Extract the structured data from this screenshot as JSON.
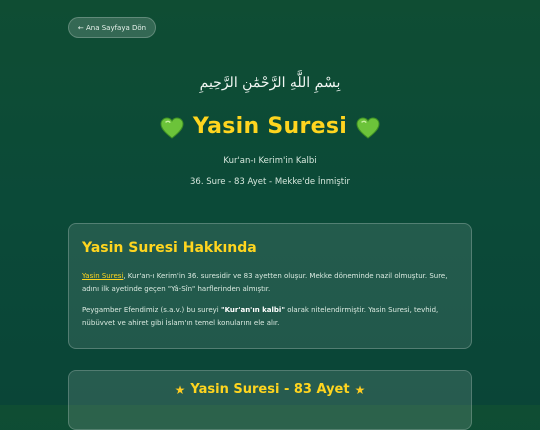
{
  "nav": {
    "back_label": "← Ana Sayfaya Dön"
  },
  "header": {
    "basmala": "بِسْمِ اللَّهِ الرَّحْمَٰنِ الرَّحِيمِ",
    "title": "Yasin Suresi",
    "title_icon": "green-heart-icon",
    "subtitle": "Kur'an-ı Kerim'in Kalbi",
    "meta": "36. Sure - 83 Ayet - Mekke'de İnmiştir"
  },
  "about": {
    "title": "Yasin Suresi Hakkında",
    "p1_link": "Yasin Suresi",
    "p1_rest": ", Kur'an-ı Kerim'in 36. suresidir ve 83 ayetten oluşur. Mekke döneminde nazil olmuştur. Sure, adını ilk ayetinde geçen \"Yâ-Sîn\" harflerinden almıştır.",
    "p2_pre": "Peygamber Efendimiz (s.a.v.) bu sureyi ",
    "p2_strong": "\"Kur'an'ın kalbi\"",
    "p2_post": " olarak nitelendirmiştir. Yasin Suresi, tevhid, nübüvvet ve ahiret gibi İslam'ın temel konularını ele alır."
  },
  "verses": {
    "title": "Yasin Suresi - 83 Ayet",
    "icon": "star-icon"
  },
  "colors": {
    "accent": "#ffd51f",
    "background": "#0b4a38",
    "heart": "#7ccf3a"
  }
}
